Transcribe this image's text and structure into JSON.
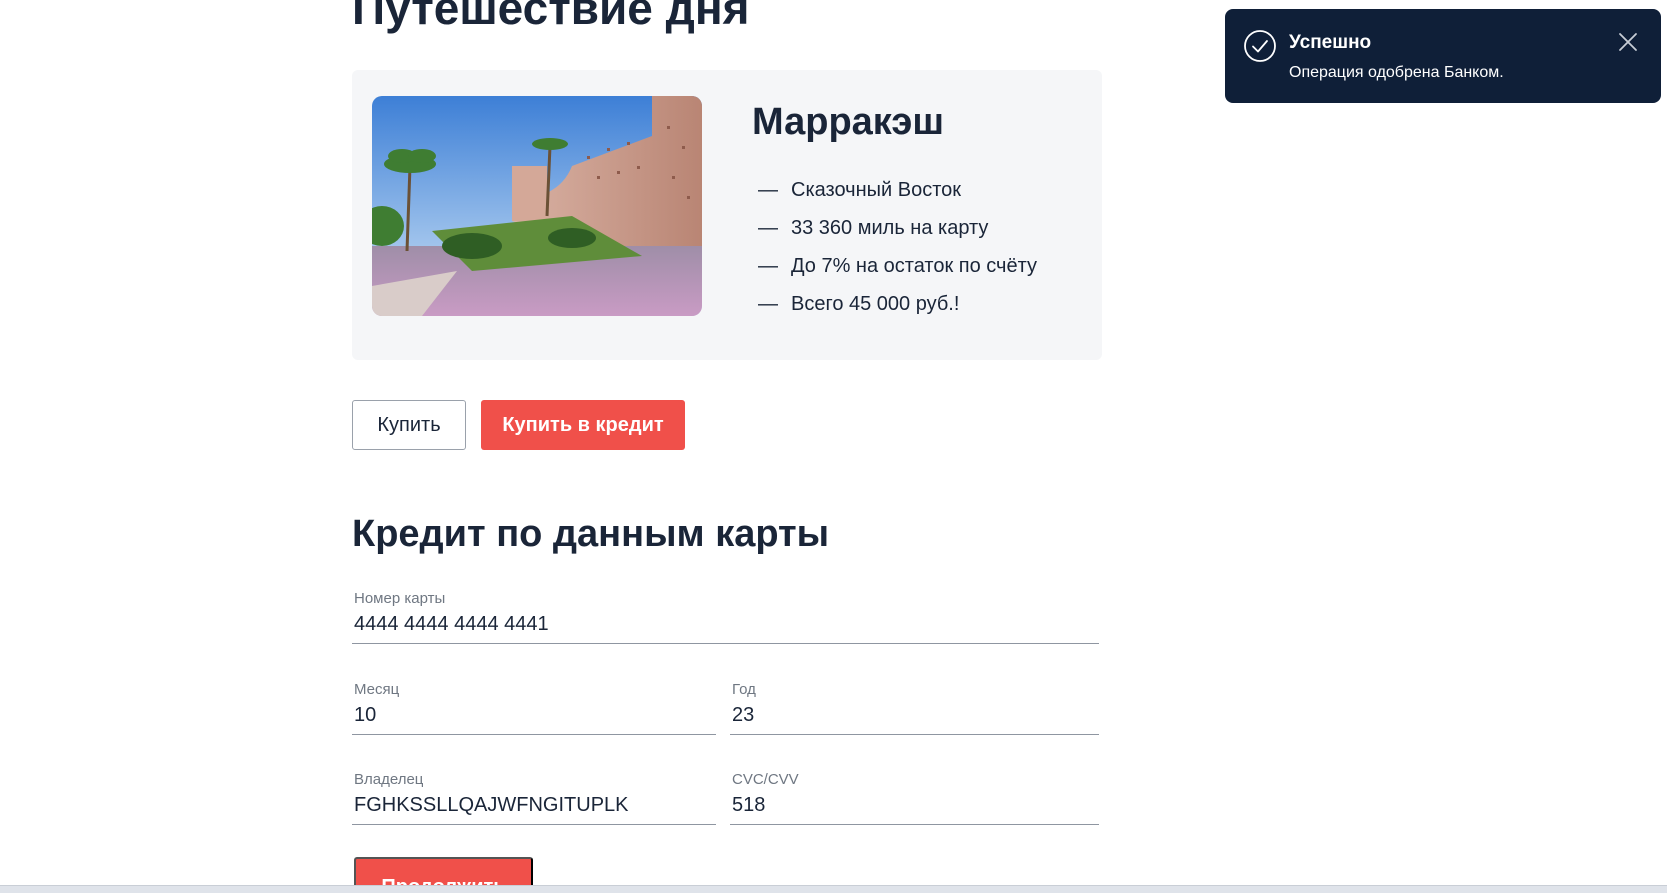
{
  "page_title": "Путешествие дня",
  "tour": {
    "title": "Марракэш",
    "image_alt": "Marrakech city wall with palm trees",
    "dash": "—",
    "features": [
      "Сказочный Восток",
      "33 360 миль на карту",
      "До 7% на остаток по счёту",
      "Всего 45 000 руб.!"
    ]
  },
  "buttons": {
    "buy": "Купить",
    "buy_credit": "Купить в кредит",
    "continue": "Продолжить"
  },
  "form": {
    "title": "Кредит по данным карты",
    "card_number": {
      "label": "Номер карты",
      "value": "4444 4444 4444 4441"
    },
    "month": {
      "label": "Месяц",
      "value": "10"
    },
    "year": {
      "label": "Год",
      "value": "23"
    },
    "owner": {
      "label": "Владелец",
      "value": "FGHKSSLLQAJWFNGITUPLK"
    },
    "cvc": {
      "label": "CVC/CVV",
      "value": "518"
    }
  },
  "notification": {
    "title": "Успешно",
    "message": "Операция одобрена Банком.",
    "icons": {
      "status": "check-circle-icon",
      "close": "close-icon"
    }
  },
  "colors": {
    "accent": "#f0504a",
    "text": "#1a2538",
    "card_bg": "#f5f6f8",
    "toast_bg": "#0f1f38"
  }
}
